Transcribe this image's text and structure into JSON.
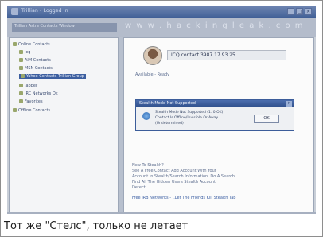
{
  "window": {
    "title": "Trillian - Logged in",
    "buttons": [
      "_",
      "□",
      "×"
    ]
  },
  "toolbar": {
    "address": "Trillian Astra Contacts Window",
    "watermark": "w w w . h a c k i n g l e a k . c o m"
  },
  "sidebar": {
    "items": [
      {
        "label": "Online Contacts",
        "selected": false
      },
      {
        "label": "Icq",
        "selected": false
      },
      {
        "label": "AIM Contacts",
        "selected": false
      },
      {
        "label": "MSN Contacts",
        "selected": false
      },
      {
        "label": "Yahoo Contacts Trillian Group",
        "selected": true
      },
      {
        "label": "Jabber",
        "selected": false
      },
      {
        "label": "IRC Networks Ok",
        "selected": false
      },
      {
        "label": "Favorites",
        "selected": false
      },
      {
        "label": "Offline Contacts",
        "selected": false
      }
    ]
  },
  "profile": {
    "contact": "ICQ contact 3987 17 93 25",
    "status": "Available - Ready"
  },
  "dialog": {
    "title": "Stealth Mode Not Supported",
    "line1": "Stealth Mode Not Supported (1. 0 OK)",
    "line2": "Contact Is Offline/Invisible Or Away",
    "line3": "(Undetermined)",
    "ok_label": "OK",
    "close": "×"
  },
  "info": {
    "line1": "New To Stealth?",
    "line2": "See A Free Contact Add Account With Your",
    "line3": "Account In Stealth/Search Information. Do A Search",
    "line4": "Find All The Hidden Users Stealth Account",
    "line5": "Detect",
    "line6": "Free IRB Networks - ..Let The Friends Kill Stealth Tab"
  },
  "caption": {
    "text": "Тот же \"Стелс\", только не летает"
  }
}
